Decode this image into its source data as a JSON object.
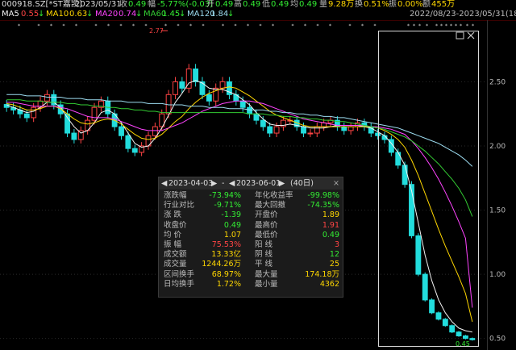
{
  "header": {
    "code": "000918.SZ[*ST嘉凯]",
    "date": "2023/05/31",
    "close_label": "收",
    "close_value": "0.49",
    "change_label": "幅",
    "change_value": "-5.77%(-0.03)",
    "open_label": "开",
    "open_value": "0.49",
    "high_label": "高",
    "high_value": "0.49",
    "low_label": "低",
    "low_value": "0.49",
    "avg_label": "均",
    "avg_value": "0.49",
    "volume_label": "量",
    "volume_value": "9.28万",
    "turnover_label": "换",
    "turnover_value": "0.51%",
    "amplitude_label": "振",
    "amplitude_value": "0.00%",
    "amount_label": "额",
    "amount_value": "455万"
  },
  "ma_legend": [
    {
      "label": "MA5",
      "value": "0.55",
      "arrow": "↓",
      "color": "#f2f2f2"
    },
    {
      "label": "MA10",
      "value": "0.63",
      "arrow": "↓",
      "color": "#ffd700"
    },
    {
      "label": "MA20",
      "value": "0.74",
      "arrow": "↓",
      "color": "#ff44ff"
    },
    {
      "label": "MA60",
      "value": "1.45",
      "arrow": "↓",
      "color": "#33cc33"
    },
    {
      "label": "MA120",
      "value": "1.84",
      "arrow": "↓",
      "color": "#9cdcf0"
    }
  ],
  "range_label": "2022/08/23-2023/05/31(186日)",
  "markers": {
    "max_label": "2.77",
    "min_label": "0.45"
  },
  "chart_data": {
    "type": "candlestick",
    "y_ticks": [
      "2.50",
      "2.00",
      "1.50",
      "1.00",
      "0.50"
    ],
    "ylim": [
      0.41,
      2.98
    ],
    "candles_count": 186,
    "max_price": 2.77,
    "min_price": 0.45,
    "close_series": [
      2.3,
      2.28,
      2.25,
      2.22,
      2.3,
      2.35,
      2.4,
      2.32,
      2.25,
      2.1,
      2.05,
      2.12,
      2.2,
      2.3,
      2.35,
      2.25,
      2.15,
      2.08,
      1.98,
      1.95,
      2.0,
      2.08,
      2.15,
      2.25,
      2.4,
      2.5,
      2.45,
      2.6,
      2.5,
      2.4,
      2.35,
      2.45,
      2.5,
      2.4,
      2.35,
      2.3,
      2.25,
      2.2,
      2.15,
      2.1,
      2.15,
      2.2,
      2.2,
      2.15,
      2.1,
      2.1,
      2.15,
      2.18,
      2.2,
      2.15,
      2.12,
      2.15,
      2.18,
      2.15,
      2.1,
      2.08,
      2.05,
      1.95,
      1.85,
      1.7,
      1.3,
      1.0,
      0.8,
      0.7,
      0.65,
      0.6,
      0.55,
      0.52,
      0.5,
      0.49
    ],
    "ma_series": [
      {
        "name": "MA5",
        "color": "#f2f2f2",
        "values": [
          2.32,
          2.3,
          2.28,
          2.26,
          2.27,
          2.3,
          2.34,
          2.34,
          2.3,
          2.22,
          2.15,
          2.1,
          2.12,
          2.18,
          2.26,
          2.28,
          2.25,
          2.18,
          2.1,
          2.02,
          1.99,
          2.0,
          2.06,
          2.14,
          2.24,
          2.34,
          2.41,
          2.49,
          2.51,
          2.49,
          2.45,
          2.44,
          2.44,
          2.42,
          2.4,
          2.36,
          2.32,
          2.26,
          2.21,
          2.17,
          2.16,
          2.16,
          2.17,
          2.16,
          2.15,
          2.14,
          2.14,
          2.14,
          2.15,
          2.16,
          2.16,
          2.16,
          2.16,
          2.15,
          2.14,
          2.11,
          2.08,
          2.02,
          1.95,
          1.85,
          1.65,
          1.4,
          1.15,
          0.95,
          0.8,
          0.7,
          0.63,
          0.58,
          0.56,
          0.55
        ]
      },
      {
        "name": "MA10",
        "color": "#ffd700",
        "values": [
          2.33,
          2.32,
          2.3,
          2.28,
          2.28,
          2.29,
          2.31,
          2.31,
          2.29,
          2.25,
          2.21,
          2.18,
          2.17,
          2.18,
          2.2,
          2.21,
          2.2,
          2.17,
          2.13,
          2.09,
          2.06,
          2.05,
          2.06,
          2.09,
          2.14,
          2.19,
          2.23,
          2.29,
          2.34,
          2.38,
          2.41,
          2.43,
          2.45,
          2.46,
          2.45,
          2.42,
          2.39,
          2.35,
          2.31,
          2.27,
          2.24,
          2.22,
          2.2,
          2.18,
          2.16,
          2.15,
          2.15,
          2.15,
          2.15,
          2.15,
          2.15,
          2.15,
          2.15,
          2.15,
          2.15,
          2.14,
          2.12,
          2.09,
          2.05,
          1.99,
          1.89,
          1.77,
          1.63,
          1.49,
          1.35,
          1.22,
          1.1,
          0.98,
          0.85,
          0.63
        ]
      },
      {
        "name": "MA20",
        "color": "#ff44ff",
        "values": [
          2.34,
          2.34,
          2.33,
          2.32,
          2.31,
          2.31,
          2.31,
          2.31,
          2.3,
          2.29,
          2.27,
          2.25,
          2.23,
          2.22,
          2.22,
          2.22,
          2.21,
          2.19,
          2.17,
          2.15,
          2.13,
          2.12,
          2.12,
          2.12,
          2.14,
          2.16,
          2.18,
          2.21,
          2.24,
          2.27,
          2.29,
          2.31,
          2.33,
          2.34,
          2.35,
          2.35,
          2.35,
          2.34,
          2.33,
          2.31,
          2.29,
          2.27,
          2.25,
          2.23,
          2.21,
          2.2,
          2.19,
          2.18,
          2.17,
          2.16,
          2.16,
          2.16,
          2.16,
          2.16,
          2.15,
          2.15,
          2.14,
          2.13,
          2.11,
          2.09,
          2.04,
          1.98,
          1.91,
          1.83,
          1.74,
          1.64,
          1.53,
          1.41,
          1.28,
          0.74
        ]
      },
      {
        "name": "MA60",
        "color": "#33cc33",
        "values": [
          2.36,
          2.36,
          2.36,
          2.35,
          2.35,
          2.35,
          2.34,
          2.34,
          2.34,
          2.33,
          2.33,
          2.32,
          2.32,
          2.31,
          2.31,
          2.3,
          2.3,
          2.29,
          2.29,
          2.28,
          2.28,
          2.27,
          2.27,
          2.26,
          2.26,
          2.26,
          2.26,
          2.26,
          2.26,
          2.26,
          2.26,
          2.26,
          2.26,
          2.26,
          2.26,
          2.26,
          2.25,
          2.25,
          2.25,
          2.24,
          2.24,
          2.23,
          2.23,
          2.22,
          2.22,
          2.21,
          2.21,
          2.2,
          2.2,
          2.19,
          2.19,
          2.18,
          2.17,
          2.16,
          2.15,
          2.14,
          2.13,
          2.11,
          2.09,
          2.07,
          2.04,
          2.0,
          1.96,
          1.91,
          1.86,
          1.8,
          1.74,
          1.67,
          1.58,
          1.45
        ]
      },
      {
        "name": "MA120",
        "color": "#9cdcf0",
        "values": [
          2.4,
          2.4,
          2.4,
          2.39,
          2.39,
          2.39,
          2.38,
          2.38,
          2.38,
          2.37,
          2.37,
          2.37,
          2.36,
          2.36,
          2.36,
          2.35,
          2.35,
          2.35,
          2.34,
          2.34,
          2.34,
          2.33,
          2.33,
          2.33,
          2.32,
          2.32,
          2.32,
          2.31,
          2.31,
          2.31,
          2.3,
          2.3,
          2.3,
          2.29,
          2.29,
          2.29,
          2.28,
          2.28,
          2.28,
          2.27,
          2.27,
          2.26,
          2.26,
          2.25,
          2.25,
          2.24,
          2.24,
          2.23,
          2.23,
          2.22,
          2.22,
          2.21,
          2.2,
          2.19,
          2.18,
          2.17,
          2.16,
          2.15,
          2.14,
          2.12,
          2.1,
          2.08,
          2.06,
          2.04,
          2.02,
          1.99,
          1.96,
          1.93,
          1.89,
          1.84
        ]
      }
    ]
  },
  "stats_panel": {
    "start_date": "2023-04-03",
    "end_date": "2023-06-01",
    "days": "(40日)",
    "rows": [
      [
        "涨跌幅",
        "-73.94%",
        "年化收益率",
        "-99.98%"
      ],
      [
        "行业对比",
        "-9.71%",
        "最大回撤",
        "-74.35%"
      ],
      [
        "涨 跌",
        "-1.39",
        "开盘价",
        "1.89"
      ],
      [
        "收盘价",
        "0.49",
        "最高价",
        "1.91"
      ],
      [
        "均 价",
        "1.07",
        "最低价",
        "0.49"
      ],
      [
        "振 幅",
        "75.53%",
        "阳 线",
        "3"
      ],
      [
        "成交额",
        "13.33亿",
        "阴 线",
        "12"
      ],
      [
        "成交量",
        "1244.26万",
        "平 线",
        "25"
      ],
      [
        "区间换手",
        "68.97%",
        "最大量",
        "174.18万"
      ],
      [
        "日均换手",
        "1.72%",
        "最小量",
        "4362"
      ]
    ],
    "row_colors": [
      [
        "#33ee33",
        "#33ee33"
      ],
      [
        "#33ee33",
        "#33ee33"
      ],
      [
        "#33ee33",
        "#ffd700"
      ],
      [
        "#33ee33",
        "#ff4444"
      ],
      [
        "#ffd700",
        "#33ee33"
      ],
      [
        "#ff4444",
        "#ff4444"
      ],
      [
        "#ffd700",
        "#33ee33"
      ],
      [
        "#ffd700",
        "#ffd700"
      ],
      [
        "#ffd700",
        "#ffd700"
      ],
      [
        "#ffd700",
        "#ffd700"
      ]
    ]
  }
}
